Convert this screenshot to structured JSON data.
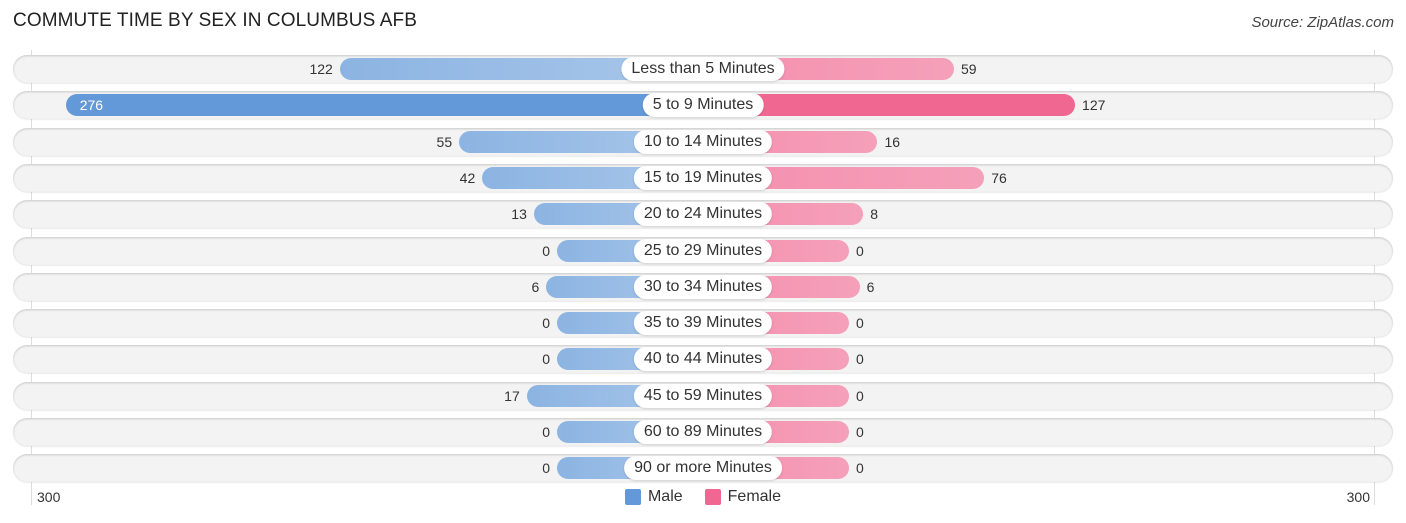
{
  "title": "COMMUTE TIME BY SEX IN COLUMBUS AFB",
  "source": "Source: ZipAtlas.com",
  "colors": {
    "male": "#8cb4e2",
    "male_strong": "#6399d8",
    "female": "#f5a0ba",
    "female_strong": "#f06792"
  },
  "chart_data": {
    "type": "bar",
    "orientation": "horizontal-diverging",
    "title": "COMMUTE TIME BY SEX IN COLUMBUS AFB",
    "categories": [
      "Less than 5 Minutes",
      "5 to 9 Minutes",
      "10 to 14 Minutes",
      "15 to 19 Minutes",
      "20 to 24 Minutes",
      "25 to 29 Minutes",
      "30 to 34 Minutes",
      "35 to 39 Minutes",
      "40 to 44 Minutes",
      "45 to 59 Minutes",
      "60 to 89 Minutes",
      "90 or more Minutes"
    ],
    "series": [
      {
        "name": "Male",
        "values": [
          122,
          276,
          55,
          42,
          13,
          0,
          6,
          0,
          0,
          17,
          0,
          0
        ]
      },
      {
        "name": "Female",
        "values": [
          59,
          127,
          16,
          76,
          8,
          0,
          6,
          0,
          0,
          0,
          0,
          0
        ]
      }
    ],
    "axis": {
      "left_tick": "300",
      "right_tick": "300",
      "range": [
        300,
        300
      ]
    },
    "legend": {
      "position": "bottom-center",
      "entries": [
        "Male",
        "Female"
      ]
    }
  }
}
